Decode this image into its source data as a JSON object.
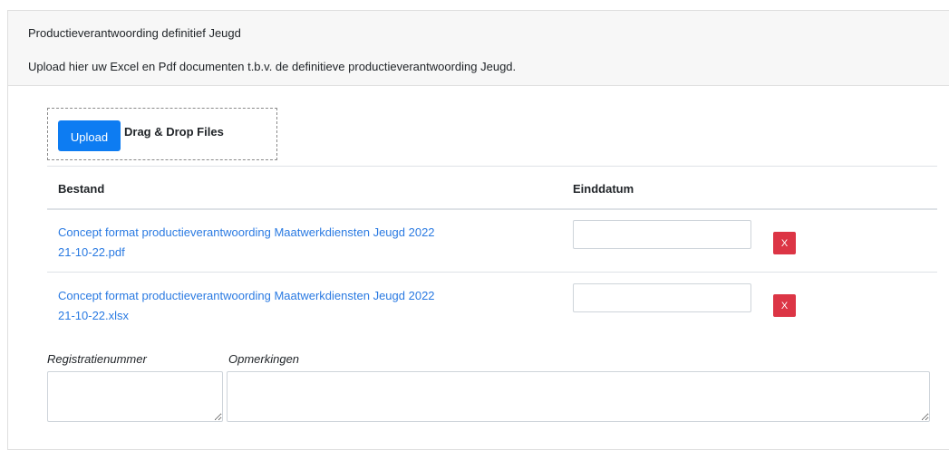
{
  "header": {
    "title": "Productieverantwoording definitief Jeugd",
    "subtitle": "Upload hier uw Excel en Pdf documenten t.b.v. de definitieve productieverantwoording Jeugd."
  },
  "dropzone": {
    "upload_label": "Upload",
    "drag_label": "Drag & Drop Files"
  },
  "table": {
    "columns": [
      "Bestand",
      "Einddatum"
    ],
    "rows": [
      {
        "file_line1": "Concept format productieverantwoording Maatwerkdiensten Jeugd 2022",
        "file_line2": "21-10-22.pdf",
        "date": "",
        "delete_label": "X"
      },
      {
        "file_line1": "Concept format productieverantwoording Maatwerkdiensten Jeugd 2022",
        "file_line2": "21-10-22.xlsx",
        "date": "",
        "delete_label": "X"
      }
    ]
  },
  "fields": {
    "registration_label": "Registratienummer",
    "registration_value": "",
    "remarks_label": "Opmerkingen",
    "remarks_value": ""
  },
  "colors": {
    "primary": "#0d7cf2",
    "danger": "#dc3545",
    "link": "#2a7ae2",
    "header_bg": "#f7f7f7"
  }
}
